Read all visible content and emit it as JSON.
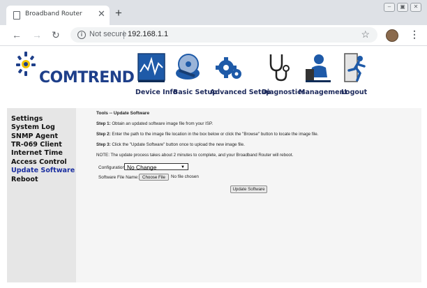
{
  "browser": {
    "tab_title": "Broadband Router",
    "not_secure": "Not secure",
    "url": "192.168.1.1"
  },
  "header": {
    "logo_text": "COMTREND",
    "nav": [
      {
        "label": "Device Info",
        "icon": "device-info-chart-icon"
      },
      {
        "label": "Basic Setup",
        "icon": "basic-setup-disc-icon"
      },
      {
        "label": "Advanced Setup",
        "icon": "advanced-setup-gears-icon"
      },
      {
        "label": "Diagnostics",
        "icon": "diagnostics-stethoscope-icon"
      },
      {
        "label": "Management",
        "icon": "management-person-icon"
      },
      {
        "label": "Logout",
        "icon": "logout-runner-icon"
      }
    ]
  },
  "sidebar": {
    "items": [
      {
        "label": "Settings"
      },
      {
        "label": "System Log"
      },
      {
        "label": "SNMP Agent"
      },
      {
        "label": "TR-069 Client"
      },
      {
        "label": "Internet Time"
      },
      {
        "label": "Access Control"
      },
      {
        "label": "Update Software",
        "active": true
      },
      {
        "label": "Reboot"
      }
    ]
  },
  "main": {
    "title": "Tools -- Update Software",
    "step1_label": "Step 1:",
    "step1_text": " Obtain an updated software image file from your ISP.",
    "step2_label": "Step 2:",
    "step2_text": " Enter the path to the image file location in the box below or click the \"Browse\" button to locate the image file.",
    "step3_label": "Step 3:",
    "step3_text": " Click the \"Update Software\" button once to upload the new image file.",
    "note": "NOTE: The update process takes about 2 minutes to complete, and your Broadband Router will reboot.",
    "configuration_label": "Configuration",
    "configuration_value": "No Change",
    "file_label": "Software File Name:",
    "choose_file": "Choose File",
    "no_file": "No file chosen",
    "update_button": "Update Software"
  },
  "colors": {
    "logo_blue": "#1e3f8a",
    "sidebar_bg": "#e6e6e6",
    "active_link": "#1a2ea0"
  }
}
